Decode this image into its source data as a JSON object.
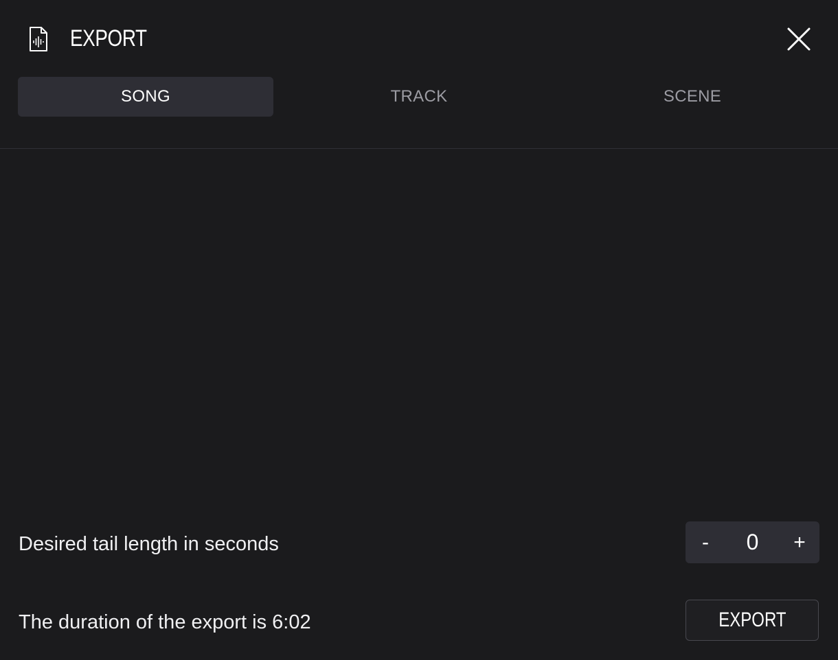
{
  "header": {
    "title": "EXPORT",
    "icon": "audio-file-icon",
    "close_icon": "close-icon"
  },
  "tabs": [
    {
      "label": "SONG",
      "active": true
    },
    {
      "label": "TRACK",
      "active": false
    },
    {
      "label": "SCENE",
      "active": false
    }
  ],
  "tail": {
    "label": "Desired tail length in seconds",
    "minus_label": "-",
    "value": "0",
    "plus_label": "+"
  },
  "footer": {
    "duration_text": "The duration of the export is 6:02",
    "export_button_label": "EXPORT"
  },
  "colors": {
    "background": "#1b1b1d",
    "active_tab": "#2e2e35",
    "inactive_text": "#9c9ca3",
    "text": "#ffffff"
  }
}
